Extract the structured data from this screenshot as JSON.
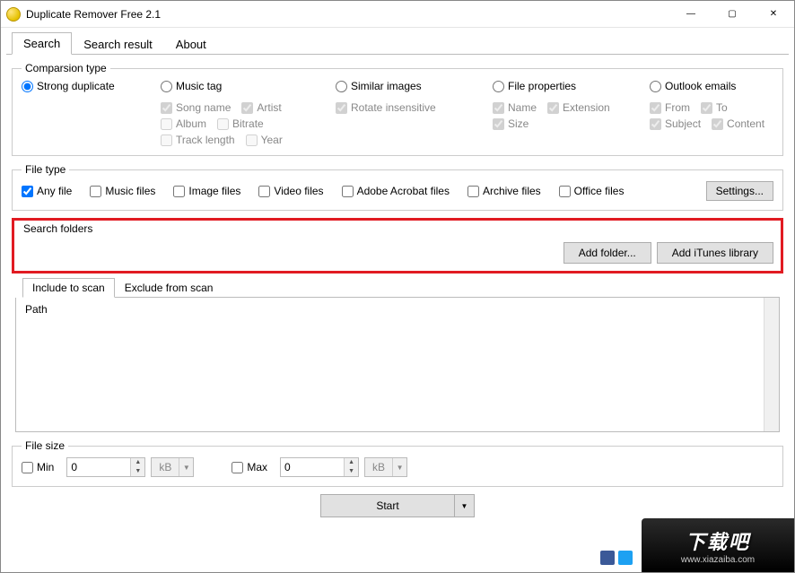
{
  "window": {
    "title": "Duplicate Remover Free 2.1"
  },
  "tabs": [
    "Search",
    "Search result",
    "About"
  ],
  "active_tab": 0,
  "comparison": {
    "legend": "Comparsion type",
    "options": {
      "strong": "Strong duplicate",
      "music": "Music tag",
      "images": "Similar images",
      "props": "File properties",
      "outlook": "Outlook emails"
    },
    "selected": "strong",
    "music_sub": {
      "song_name": "Song name",
      "artist": "Artist",
      "album": "Album",
      "bitrate": "Bitrate",
      "track_length": "Track length",
      "year": "Year",
      "checked": [
        "song_name",
        "artist"
      ]
    },
    "images_sub": {
      "rotate": "Rotate insensitive",
      "checked": [
        "rotate"
      ]
    },
    "props_sub": {
      "name": "Name",
      "extension": "Extension",
      "size": "Size",
      "checked": [
        "name",
        "extension",
        "size"
      ]
    },
    "outlook_sub": {
      "from": "From",
      "to": "To",
      "subject": "Subject",
      "content": "Content",
      "checked": [
        "from",
        "to",
        "subject",
        "content"
      ]
    }
  },
  "filetype": {
    "legend": "File type",
    "items": {
      "any": "Any file",
      "music": "Music files",
      "image": "Image files",
      "video": "Video files",
      "acrobat": "Adobe Acrobat files",
      "archive": "Archive files",
      "office": "Office files"
    },
    "checked": [
      "any"
    ],
    "settings_btn": "Settings..."
  },
  "search_folders": {
    "legend": "Search folders",
    "add_folder_btn": "Add folder...",
    "add_itunes_btn": "Add iTunes library"
  },
  "scan_tabs": {
    "include": "Include to scan",
    "exclude": "Exclude from scan",
    "active": "include",
    "path_header": "Path"
  },
  "filesize": {
    "legend": "File size",
    "min_label": "Min",
    "max_label": "Max",
    "min_value": "0",
    "max_value": "0",
    "unit": "kB"
  },
  "start_btn": "Start",
  "watermark": {
    "text": "下载吧",
    "url": "www.xiazaiba.com"
  }
}
